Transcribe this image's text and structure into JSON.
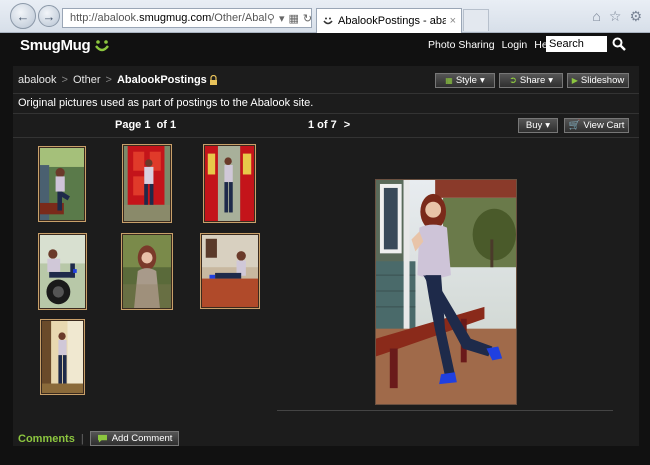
{
  "browser": {
    "address_prefix": "http://abalook.",
    "address_host": "smugmug.com",
    "address_path": "/Other/Abal",
    "tab_title": "AbalookPostings - abalook'...",
    "tab_close": "×"
  },
  "header": {
    "logo": "SmugMug",
    "links": [
      "Photo Sharing",
      "Login",
      "Help"
    ],
    "search_value": "Search"
  },
  "breadcrumb": {
    "items": [
      "abalook",
      "Other"
    ],
    "current": "AbalookPostings",
    "separator": ">"
  },
  "toolbar": {
    "style_label": "Style",
    "share_label": "Share",
    "slideshow_label": "Slideshow",
    "buy_label": "Buy",
    "cart_label": "View Cart"
  },
  "gallery": {
    "description": "Original pictures used as part of postings to the Abalook site.",
    "pager": "Page 1  of 1",
    "photo_position": "1 of 7",
    "next_arrow": ">"
  },
  "comments": {
    "label": "Comments",
    "pipe": "|",
    "add_label": "Add Comment"
  },
  "colors": {
    "accent_green": "#8cc63f",
    "page_bg": "#111111",
    "panel_bg": "#1c1c1c"
  }
}
